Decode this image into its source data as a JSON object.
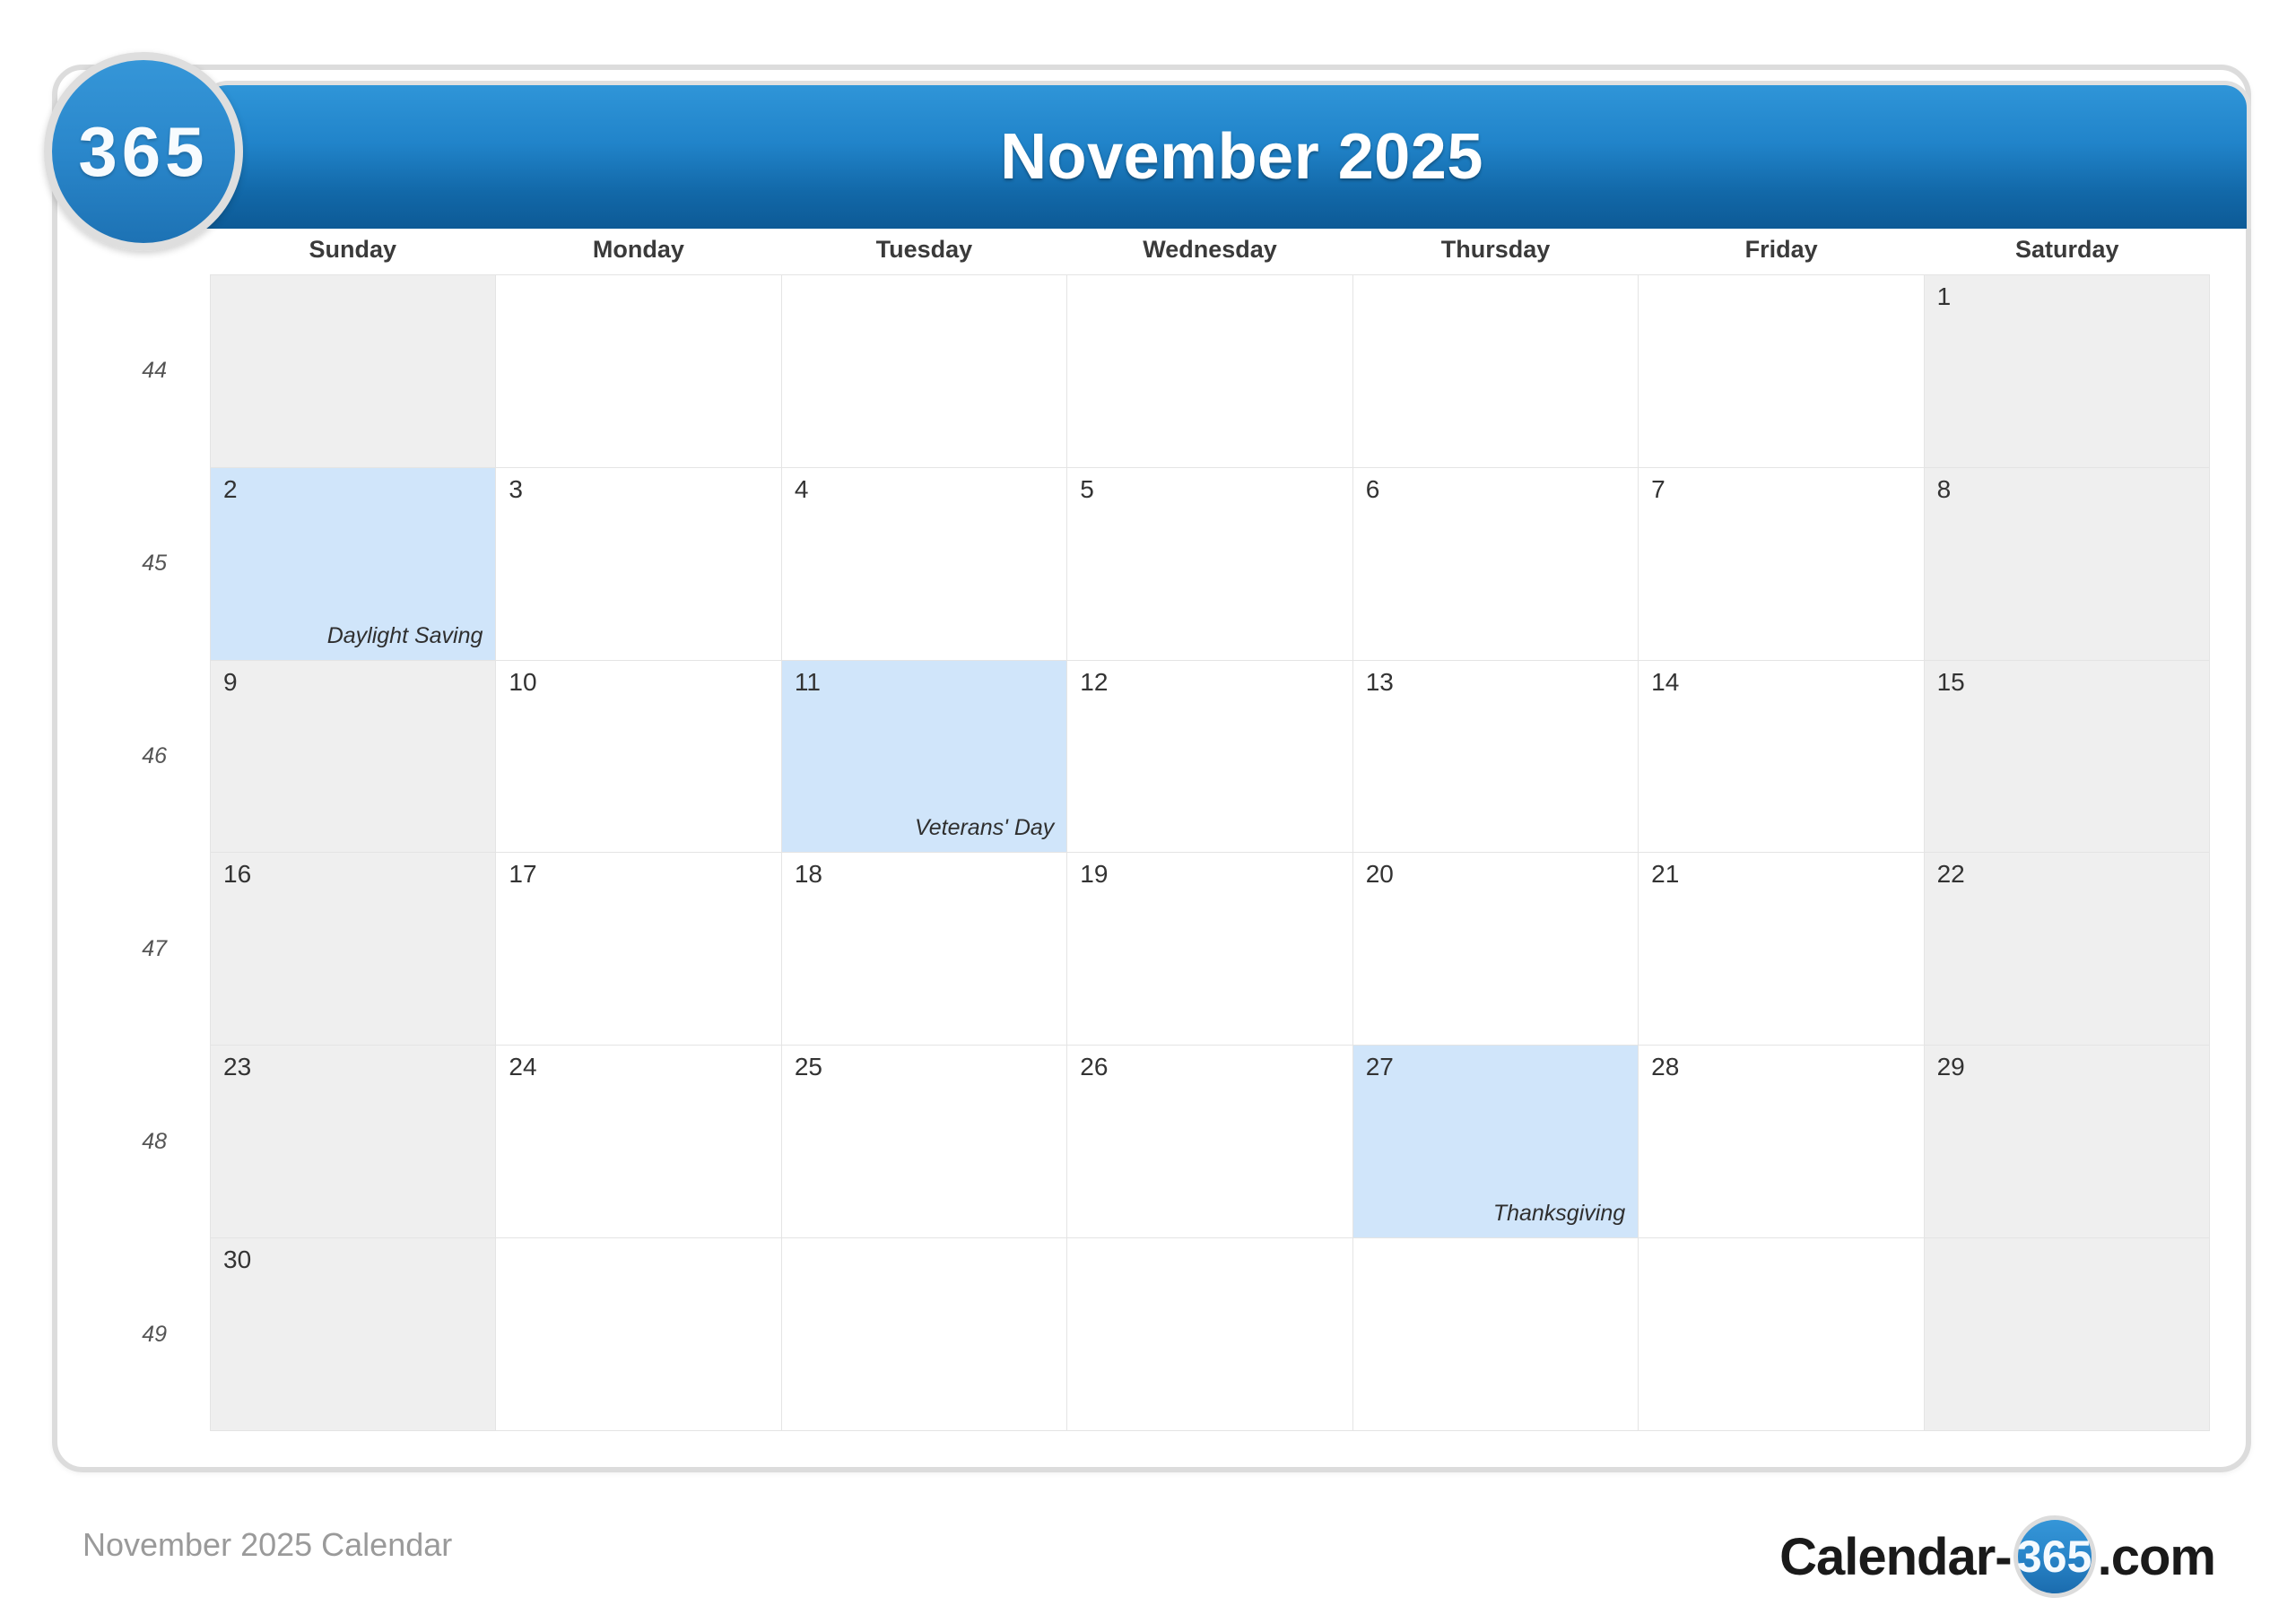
{
  "brand": {
    "badge_text": "365",
    "footer_logo_prefix": "Calendar-",
    "footer_logo_circle": "365",
    "footer_logo_suffix": ".com"
  },
  "header": {
    "title": "November 2025"
  },
  "weekdays": [
    "Sunday",
    "Monday",
    "Tuesday",
    "Wednesday",
    "Thursday",
    "Friday",
    "Saturday"
  ],
  "week_numbers": [
    "44",
    "45",
    "46",
    "47",
    "48",
    "49"
  ],
  "weeks": [
    [
      {
        "day": "",
        "event": "",
        "weekend": true,
        "holiday": false,
        "empty": true
      },
      {
        "day": "",
        "event": "",
        "weekend": false,
        "holiday": false,
        "empty": true
      },
      {
        "day": "",
        "event": "",
        "weekend": false,
        "holiday": false,
        "empty": true
      },
      {
        "day": "",
        "event": "",
        "weekend": false,
        "holiday": false,
        "empty": true
      },
      {
        "day": "",
        "event": "",
        "weekend": false,
        "holiday": false,
        "empty": true
      },
      {
        "day": "",
        "event": "",
        "weekend": false,
        "holiday": false,
        "empty": true
      },
      {
        "day": "1",
        "event": "",
        "weekend": true,
        "holiday": false,
        "empty": false
      }
    ],
    [
      {
        "day": "2",
        "event": "Daylight Saving",
        "weekend": true,
        "holiday": true,
        "empty": false
      },
      {
        "day": "3",
        "event": "",
        "weekend": false,
        "holiday": false,
        "empty": false
      },
      {
        "day": "4",
        "event": "",
        "weekend": false,
        "holiday": false,
        "empty": false
      },
      {
        "day": "5",
        "event": "",
        "weekend": false,
        "holiday": false,
        "empty": false
      },
      {
        "day": "6",
        "event": "",
        "weekend": false,
        "holiday": false,
        "empty": false
      },
      {
        "day": "7",
        "event": "",
        "weekend": false,
        "holiday": false,
        "empty": false
      },
      {
        "day": "8",
        "event": "",
        "weekend": true,
        "holiday": false,
        "empty": false
      }
    ],
    [
      {
        "day": "9",
        "event": "",
        "weekend": true,
        "holiday": false,
        "empty": false
      },
      {
        "day": "10",
        "event": "",
        "weekend": false,
        "holiday": false,
        "empty": false
      },
      {
        "day": "11",
        "event": "Veterans' Day",
        "weekend": false,
        "holiday": true,
        "empty": false
      },
      {
        "day": "12",
        "event": "",
        "weekend": false,
        "holiday": false,
        "empty": false
      },
      {
        "day": "13",
        "event": "",
        "weekend": false,
        "holiday": false,
        "empty": false
      },
      {
        "day": "14",
        "event": "",
        "weekend": false,
        "holiday": false,
        "empty": false
      },
      {
        "day": "15",
        "event": "",
        "weekend": true,
        "holiday": false,
        "empty": false
      }
    ],
    [
      {
        "day": "16",
        "event": "",
        "weekend": true,
        "holiday": false,
        "empty": false
      },
      {
        "day": "17",
        "event": "",
        "weekend": false,
        "holiday": false,
        "empty": false
      },
      {
        "day": "18",
        "event": "",
        "weekend": false,
        "holiday": false,
        "empty": false
      },
      {
        "day": "19",
        "event": "",
        "weekend": false,
        "holiday": false,
        "empty": false
      },
      {
        "day": "20",
        "event": "",
        "weekend": false,
        "holiday": false,
        "empty": false
      },
      {
        "day": "21",
        "event": "",
        "weekend": false,
        "holiday": false,
        "empty": false
      },
      {
        "day": "22",
        "event": "",
        "weekend": true,
        "holiday": false,
        "empty": false
      }
    ],
    [
      {
        "day": "23",
        "event": "",
        "weekend": true,
        "holiday": false,
        "empty": false
      },
      {
        "day": "24",
        "event": "",
        "weekend": false,
        "holiday": false,
        "empty": false
      },
      {
        "day": "25",
        "event": "",
        "weekend": false,
        "holiday": false,
        "empty": false
      },
      {
        "day": "26",
        "event": "",
        "weekend": false,
        "holiday": false,
        "empty": false
      },
      {
        "day": "27",
        "event": "Thanksgiving",
        "weekend": false,
        "holiday": true,
        "empty": false
      },
      {
        "day": "28",
        "event": "",
        "weekend": false,
        "holiday": false,
        "empty": false
      },
      {
        "day": "29",
        "event": "",
        "weekend": true,
        "holiday": false,
        "empty": false
      }
    ],
    [
      {
        "day": "30",
        "event": "",
        "weekend": true,
        "holiday": false,
        "empty": false
      },
      {
        "day": "",
        "event": "",
        "weekend": false,
        "holiday": false,
        "empty": true
      },
      {
        "day": "",
        "event": "",
        "weekend": false,
        "holiday": false,
        "empty": true
      },
      {
        "day": "",
        "event": "",
        "weekend": false,
        "holiday": false,
        "empty": true
      },
      {
        "day": "",
        "event": "",
        "weekend": false,
        "holiday": false,
        "empty": true
      },
      {
        "day": "",
        "event": "",
        "weekend": false,
        "holiday": false,
        "empty": true
      },
      {
        "day": "",
        "event": "",
        "weekend": true,
        "holiday": false,
        "empty": true
      }
    ]
  ],
  "footer": {
    "caption": "November 2025 Calendar"
  },
  "colors": {
    "header_blue_light": "#2f95d8",
    "header_blue_dark": "#0d5a96",
    "holiday_blue": "#d0e5fa",
    "weekend_grey": "#efefef",
    "grid_line": "#e4e4e4",
    "card_border": "#dcdcdc"
  },
  "watermark": {
    "text": "365"
  }
}
